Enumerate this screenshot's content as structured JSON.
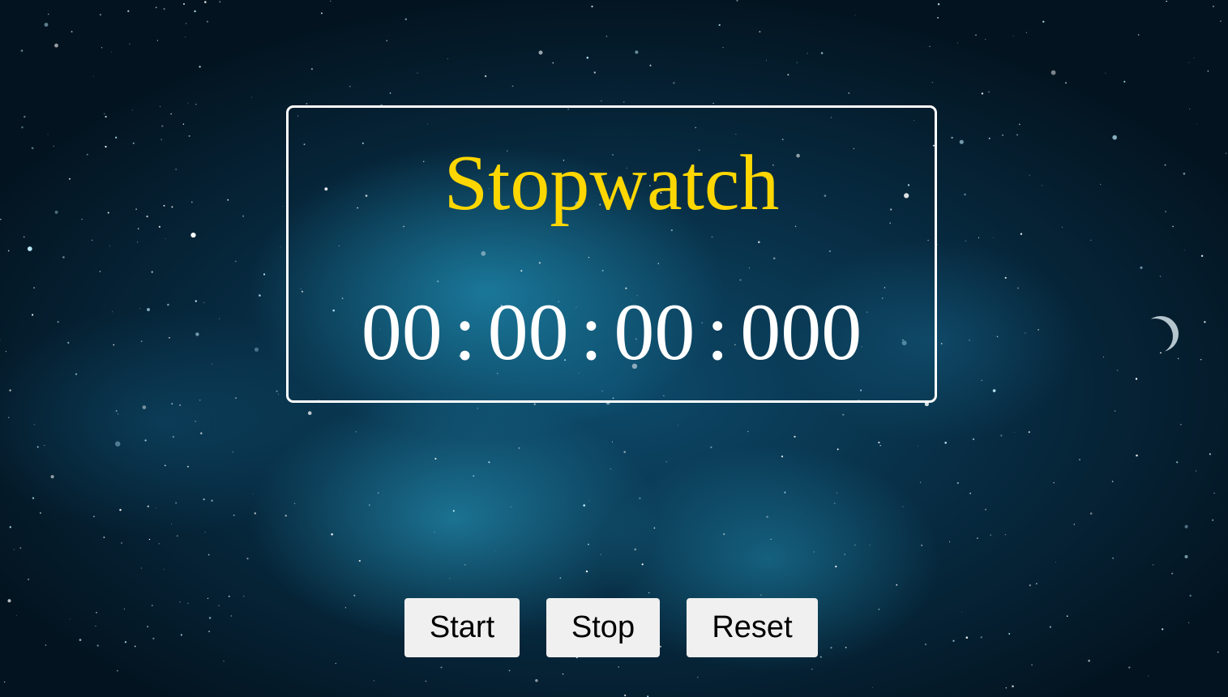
{
  "title": "Stopwatch",
  "time": {
    "hours": "00",
    "minutes": "00",
    "seconds": "00",
    "milliseconds": "000",
    "separator": ":"
  },
  "buttons": {
    "start": "Start",
    "stop": "Stop",
    "reset": "Reset"
  },
  "colors": {
    "title": "#ffd700",
    "time": "#ffffff",
    "button_bg": "#f0f0f0"
  }
}
